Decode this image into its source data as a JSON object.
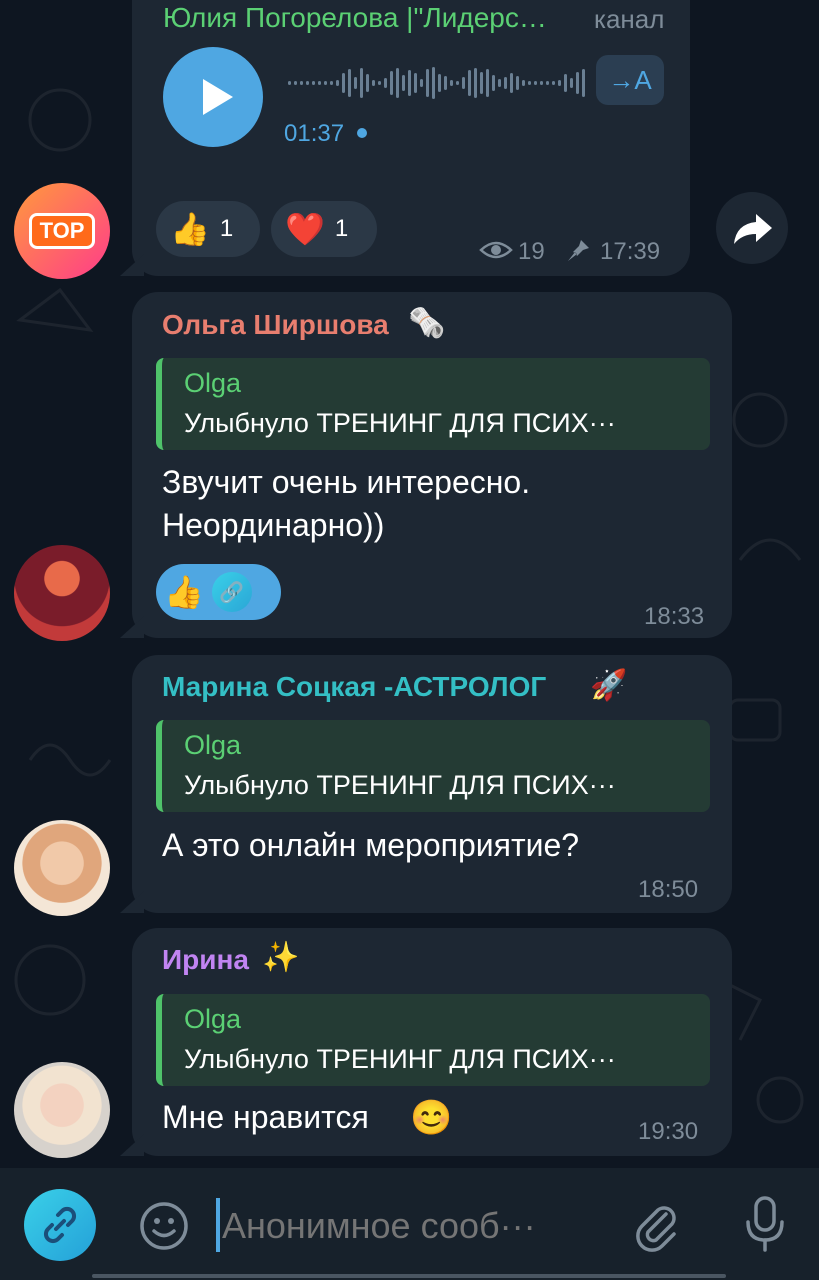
{
  "channel_message": {
    "sender": "Юлия Погорелова |\"Лидерс…",
    "channel_label": "канал",
    "duration": "01:37",
    "transcribe_label": "→A",
    "reactions": [
      {
        "emoji": "thumbs-up",
        "count": "1"
      },
      {
        "emoji": "heart",
        "count": "1"
      }
    ],
    "views": "19",
    "time": "17:39",
    "avatar_text": "TOP"
  },
  "messages": [
    {
      "sender": "Ольга Ширшова",
      "sender_color": "#e87e6f",
      "quote_name": "Olga",
      "quote_text": "Улыбнуло ТРЕНИНГ ДЛЯ ПСИХ···",
      "text_line1": "Звучит очень интересно.",
      "text_line2": "Неординарно))",
      "time": "18:33"
    },
    {
      "sender": "Марина Соцкая -АСТРОЛОГ",
      "sender_color": "#34bfc5",
      "quote_name": "Olga",
      "quote_text": "Улыбнуло ТРЕНИНГ ДЛЯ ПСИХ···",
      "text_line1": "А это онлайн мероприятие?",
      "time": "18:50"
    },
    {
      "sender": "Ирина",
      "sender_color": "#c184f2",
      "quote_name": "Olga",
      "quote_text": "Улыбнуло ТРЕНИНГ ДЛЯ ПСИХ···",
      "text_line1": "Мне нравится",
      "time": "19:30"
    }
  ],
  "input": {
    "placeholder": "Анонимное сооб···"
  },
  "colors": {
    "background": "#0e1621",
    "bubble": "#1d2733",
    "accent": "#4fa7e2",
    "quote_bg": "#243b34",
    "quote_border": "#4fc36a"
  }
}
